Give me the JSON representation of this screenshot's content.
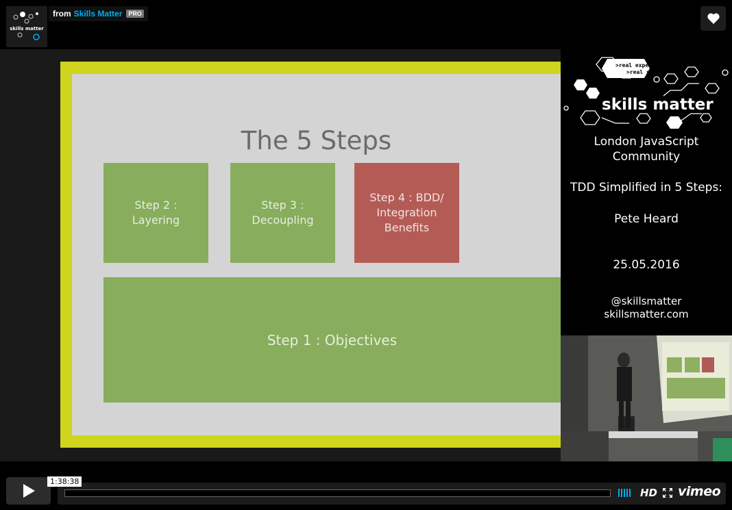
{
  "header": {
    "from_label": "from",
    "author": "Skills Matter",
    "badge": "PRO",
    "channel_logo_text": "skills matter",
    "like_icon": "heart-icon"
  },
  "slide": {
    "title": "The 5 Steps",
    "step2": "Step 2 : Layering",
    "step3": "Step 3 : Decoupling",
    "step4": "Step 4 : BDD/ Integration Benefits",
    "step1": "Step 1 : Objectives"
  },
  "sidepanel": {
    "tagline1": ">real experts",
    "tagline2": ">real skills",
    "brand": "skills matter",
    "event_line1": "London JavaScript",
    "event_line2": "Community",
    "talk_title": "TDD Simplified in 5 Steps:",
    "speaker": "Pete Heard",
    "date": "25.05.2016",
    "twitter": "@skillsmatter",
    "website": "skillsmatter.com"
  },
  "controls": {
    "time": "1:38:38",
    "hd_label": "HD",
    "vimeo_label": "vimeo",
    "play_icon": "play-icon",
    "fullscreen_icon": "fullscreen-icon",
    "progress": 0.0
  },
  "colors": {
    "accent": "#00adef",
    "slide_border": "#cfd51c",
    "step_green": "#88ad5c",
    "step_red": "#b55b56"
  }
}
